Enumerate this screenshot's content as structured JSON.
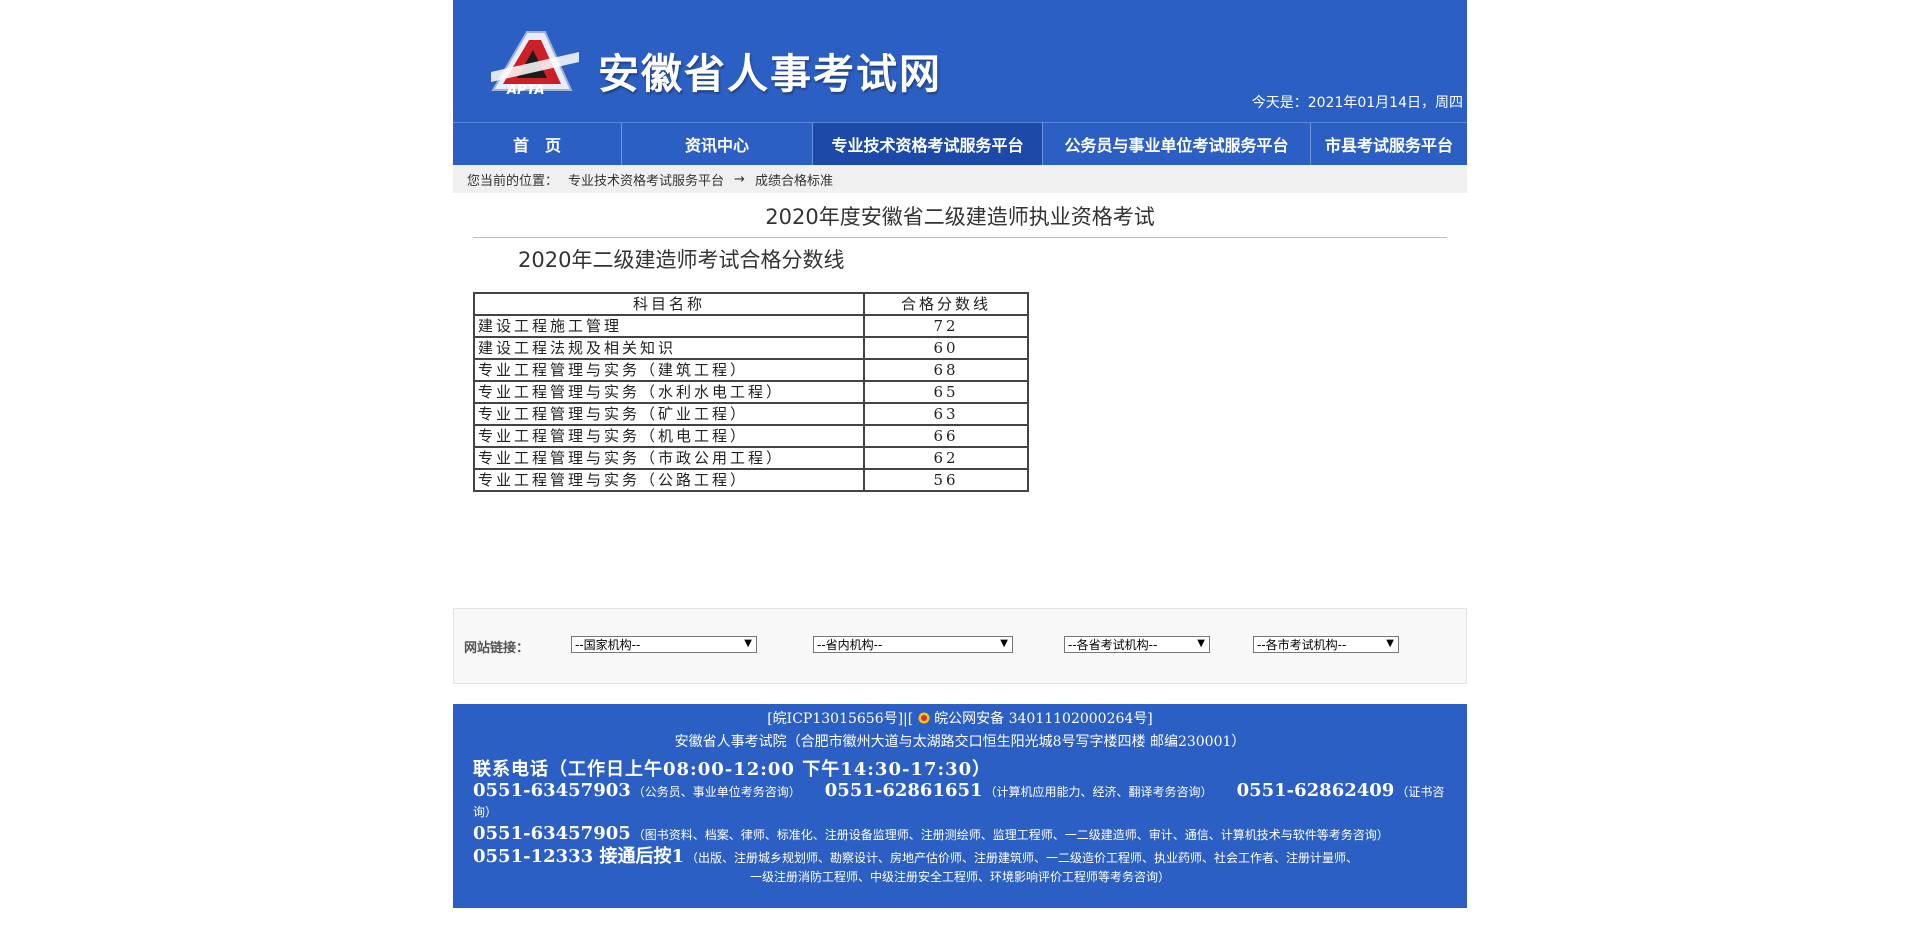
{
  "header": {
    "logo_text": "APTA",
    "site_title": "安徽省人事考试网",
    "date_line": "今天是：2021年01月14日，周四"
  },
  "nav": {
    "items": [
      {
        "label": "首　页",
        "active": false
      },
      {
        "label": "资讯中心",
        "active": false
      },
      {
        "label": "专业技术资格考试服务平台",
        "active": true
      },
      {
        "label": "公务员与事业单位考试服务平台",
        "active": false
      },
      {
        "label": "市县考试服务平台",
        "active": false
      }
    ]
  },
  "breadcrumb": {
    "prefix": "您当前的位置：",
    "level1": "专业技术资格考试服务平台",
    "arrow": "→",
    "level2": "成绩合格标准"
  },
  "article": {
    "title": "2020年度安徽省二级建造师执业资格考试",
    "subtitle": "2020年二级建造师考试合格分数线",
    "table": {
      "headers": [
        "科目名称",
        "合格分数线"
      ],
      "rows": [
        {
          "name": "建设工程施工管理",
          "score": "72"
        },
        {
          "name": "建设工程法规及相关知识",
          "score": "60"
        },
        {
          "name": "专业工程管理与实务（建筑工程）",
          "score": "68"
        },
        {
          "name": "专业工程管理与实务（水利水电工程）",
          "score": "65"
        },
        {
          "name": "专业工程管理与实务（矿业工程）",
          "score": "63"
        },
        {
          "name": "专业工程管理与实务（机电工程）",
          "score": "66"
        },
        {
          "name": "专业工程管理与实务（市政公用工程）",
          "score": "62"
        },
        {
          "name": "专业工程管理与实务（公路工程）",
          "score": "56"
        }
      ]
    }
  },
  "links": {
    "label": "网站链接：",
    "selects": [
      "--国家机构--",
      "--省内机构--",
      "--各省考试机构--",
      "--各市考试机构--"
    ]
  },
  "footer": {
    "icp": "[皖ICP13015656号]|[",
    "police": "皖公网安备 34011102000264号]",
    "address": "安徽省人事考试院（合肥市徽州大道与太湖路交口恒生阳光城8号写字楼四楼 邮编230001）",
    "contact_heading": "联系电话（工作日上午08:00-12:00  下午14:30-17:30）",
    "line1": {
      "phone_a": "0551-63457903",
      "desc_a": "（公务员、事业单位考务咨询）",
      "phone_b": "0551-62861651",
      "desc_b": "（计算机应用能力、经济、翻译考务咨询）",
      "phone_c": "0551-62862409",
      "desc_c": "（证书咨询）"
    },
    "line2": {
      "phone": "0551-63457905",
      "desc": "（图书资料、档案、律师、标准化、注册设备监理师、注册测绘师、监理工程师、一二级建造师、审计、通信、计算机技术与软件等考务咨询）"
    },
    "line3": {
      "phone": "0551-12333  接通后按1",
      "desc": "（出版、注册城乡规划师、勘察设计、房地产估价师、注册建筑师、一二级造价工程师、执业药师、社会工作者、注册计量师、",
      "desc_cont": "一级注册消防工程师、中级注册安全工程师、环境影响评价工程师等考务咨询）"
    }
  },
  "colors": {
    "brand_blue": "#2c5fc3",
    "nav_active": "#1d4aa8",
    "breadcrumb_bg": "#f0f0f0"
  }
}
